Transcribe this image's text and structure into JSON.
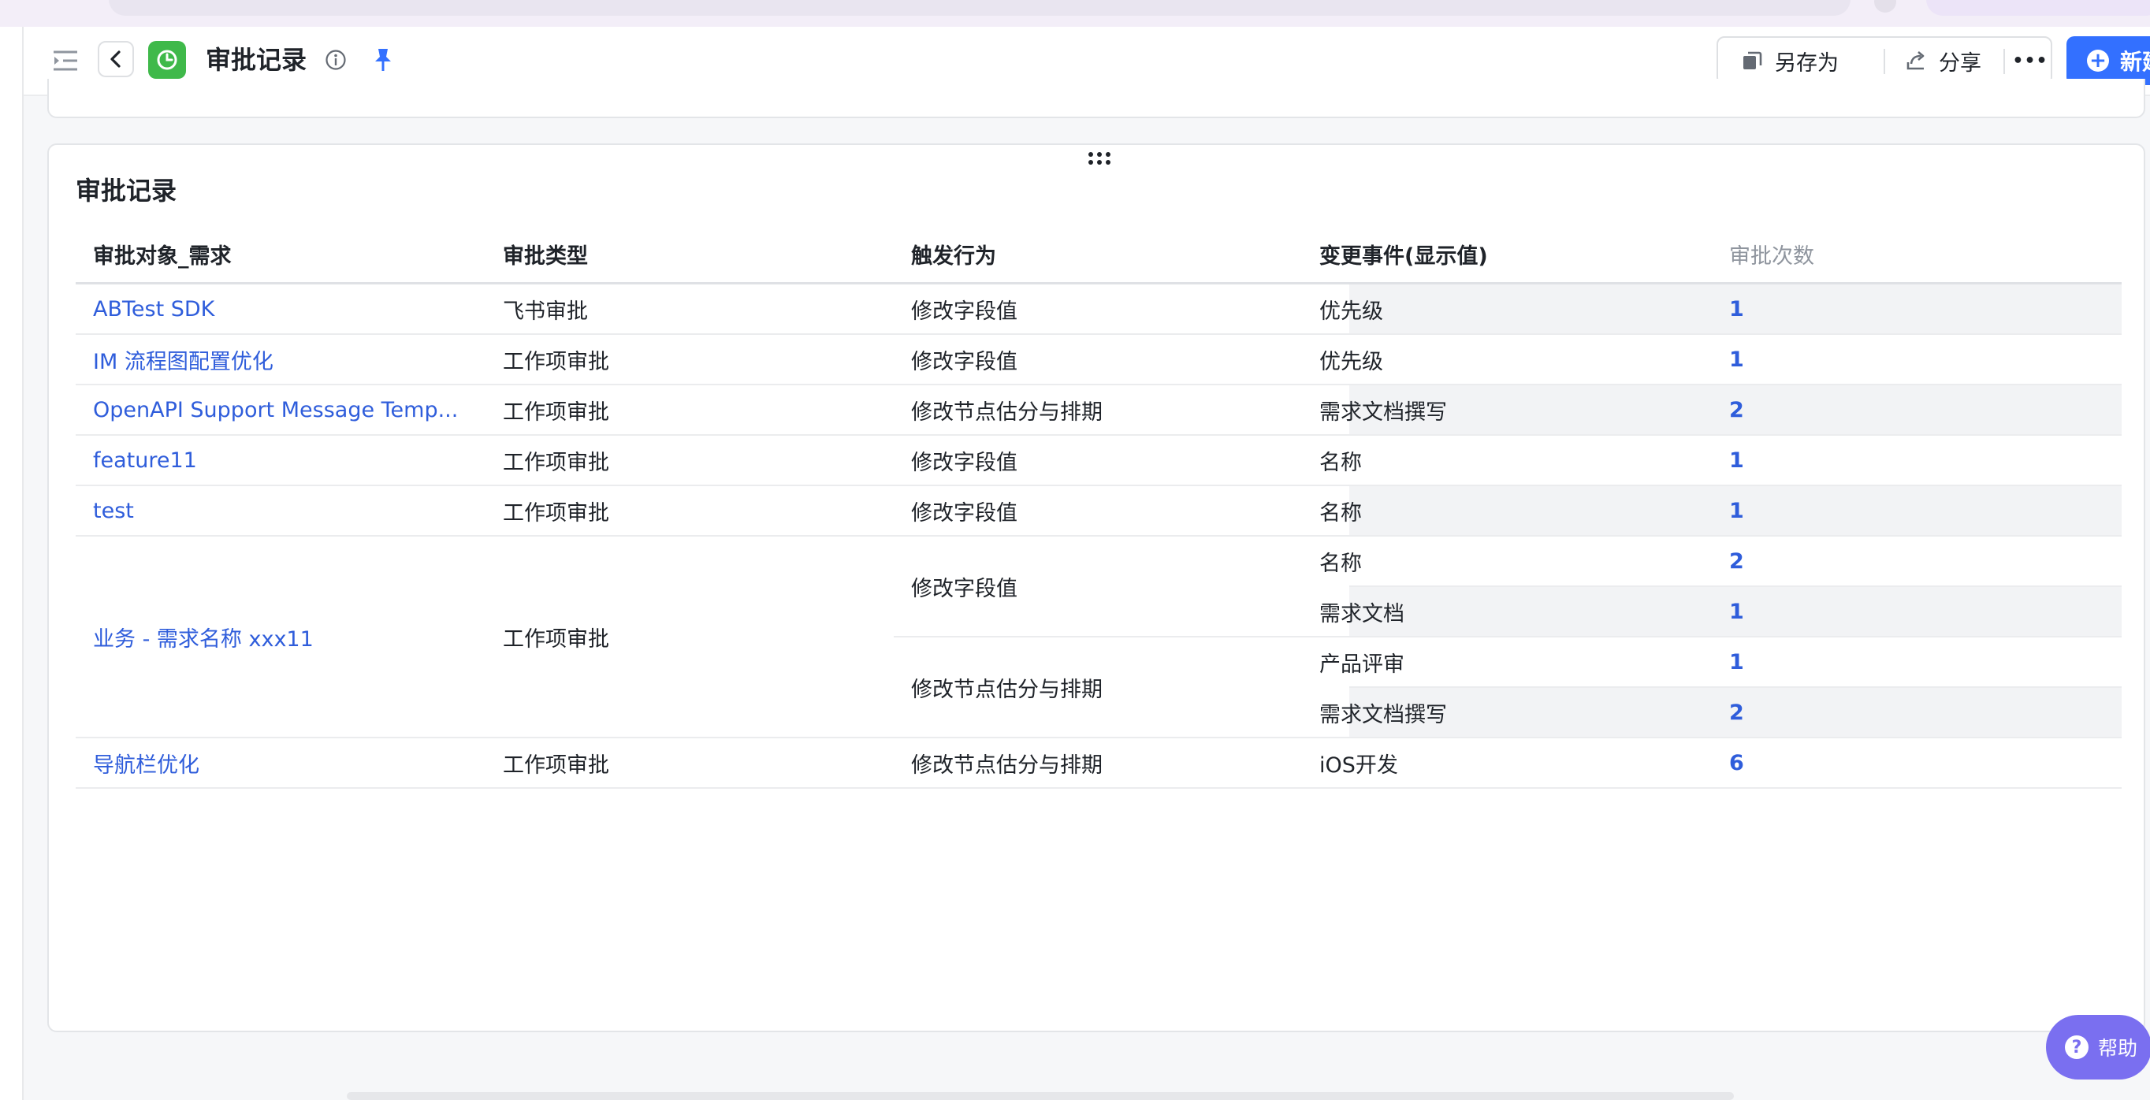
{
  "header": {
    "title": "审批记录",
    "save_as_label": "另存为",
    "share_label": "分享",
    "more_label": "•••",
    "new_label": "新建"
  },
  "card": {
    "title": "审批记录"
  },
  "table": {
    "columns": [
      "审批对象_需求",
      "审批类型",
      "触发行为",
      "变更事件(显示值)",
      "审批次数"
    ],
    "rows": [
      {
        "object": "ABTest SDK",
        "type": "飞书审批",
        "action": "修改字段值",
        "event": "优先级",
        "count": "1"
      },
      {
        "object": "IM 流程图配置优化",
        "type": "工作项审批",
        "action": "修改字段值",
        "event": "优先级",
        "count": "1"
      },
      {
        "object": "OpenAPI Support Message Temp...",
        "type": "工作项审批",
        "action": "修改节点估分与排期",
        "event": "需求文档撰写",
        "count": "2"
      },
      {
        "object": "feature11",
        "type": "工作项审批",
        "action": "修改字段值",
        "event": "名称",
        "count": "1"
      },
      {
        "object": "test",
        "type": "工作项审批",
        "action": "修改字段值",
        "event": "名称",
        "count": "1"
      },
      {
        "object": "业务 - 需求名称 xxx11",
        "type": "工作项审批",
        "action": "修改字段值",
        "event": "名称",
        "count": "2"
      },
      {
        "event": "需求文档",
        "count": "1"
      },
      {
        "action": "修改节点估分与排期",
        "event": "产品评审",
        "count": "1"
      },
      {
        "event": "需求文档撰写",
        "count": "2"
      },
      {
        "object": "导航栏优化",
        "type": "工作项审批",
        "action": "修改节点估分与排期",
        "event": "iOS开发",
        "count": "6"
      }
    ]
  },
  "help": {
    "label": "帮助",
    "icon_glyph": "?"
  },
  "colors": {
    "accent": "#3370ff",
    "link": "#2f5ddb",
    "app_icon": "#3fb94a",
    "help": "#7a6ff0"
  }
}
